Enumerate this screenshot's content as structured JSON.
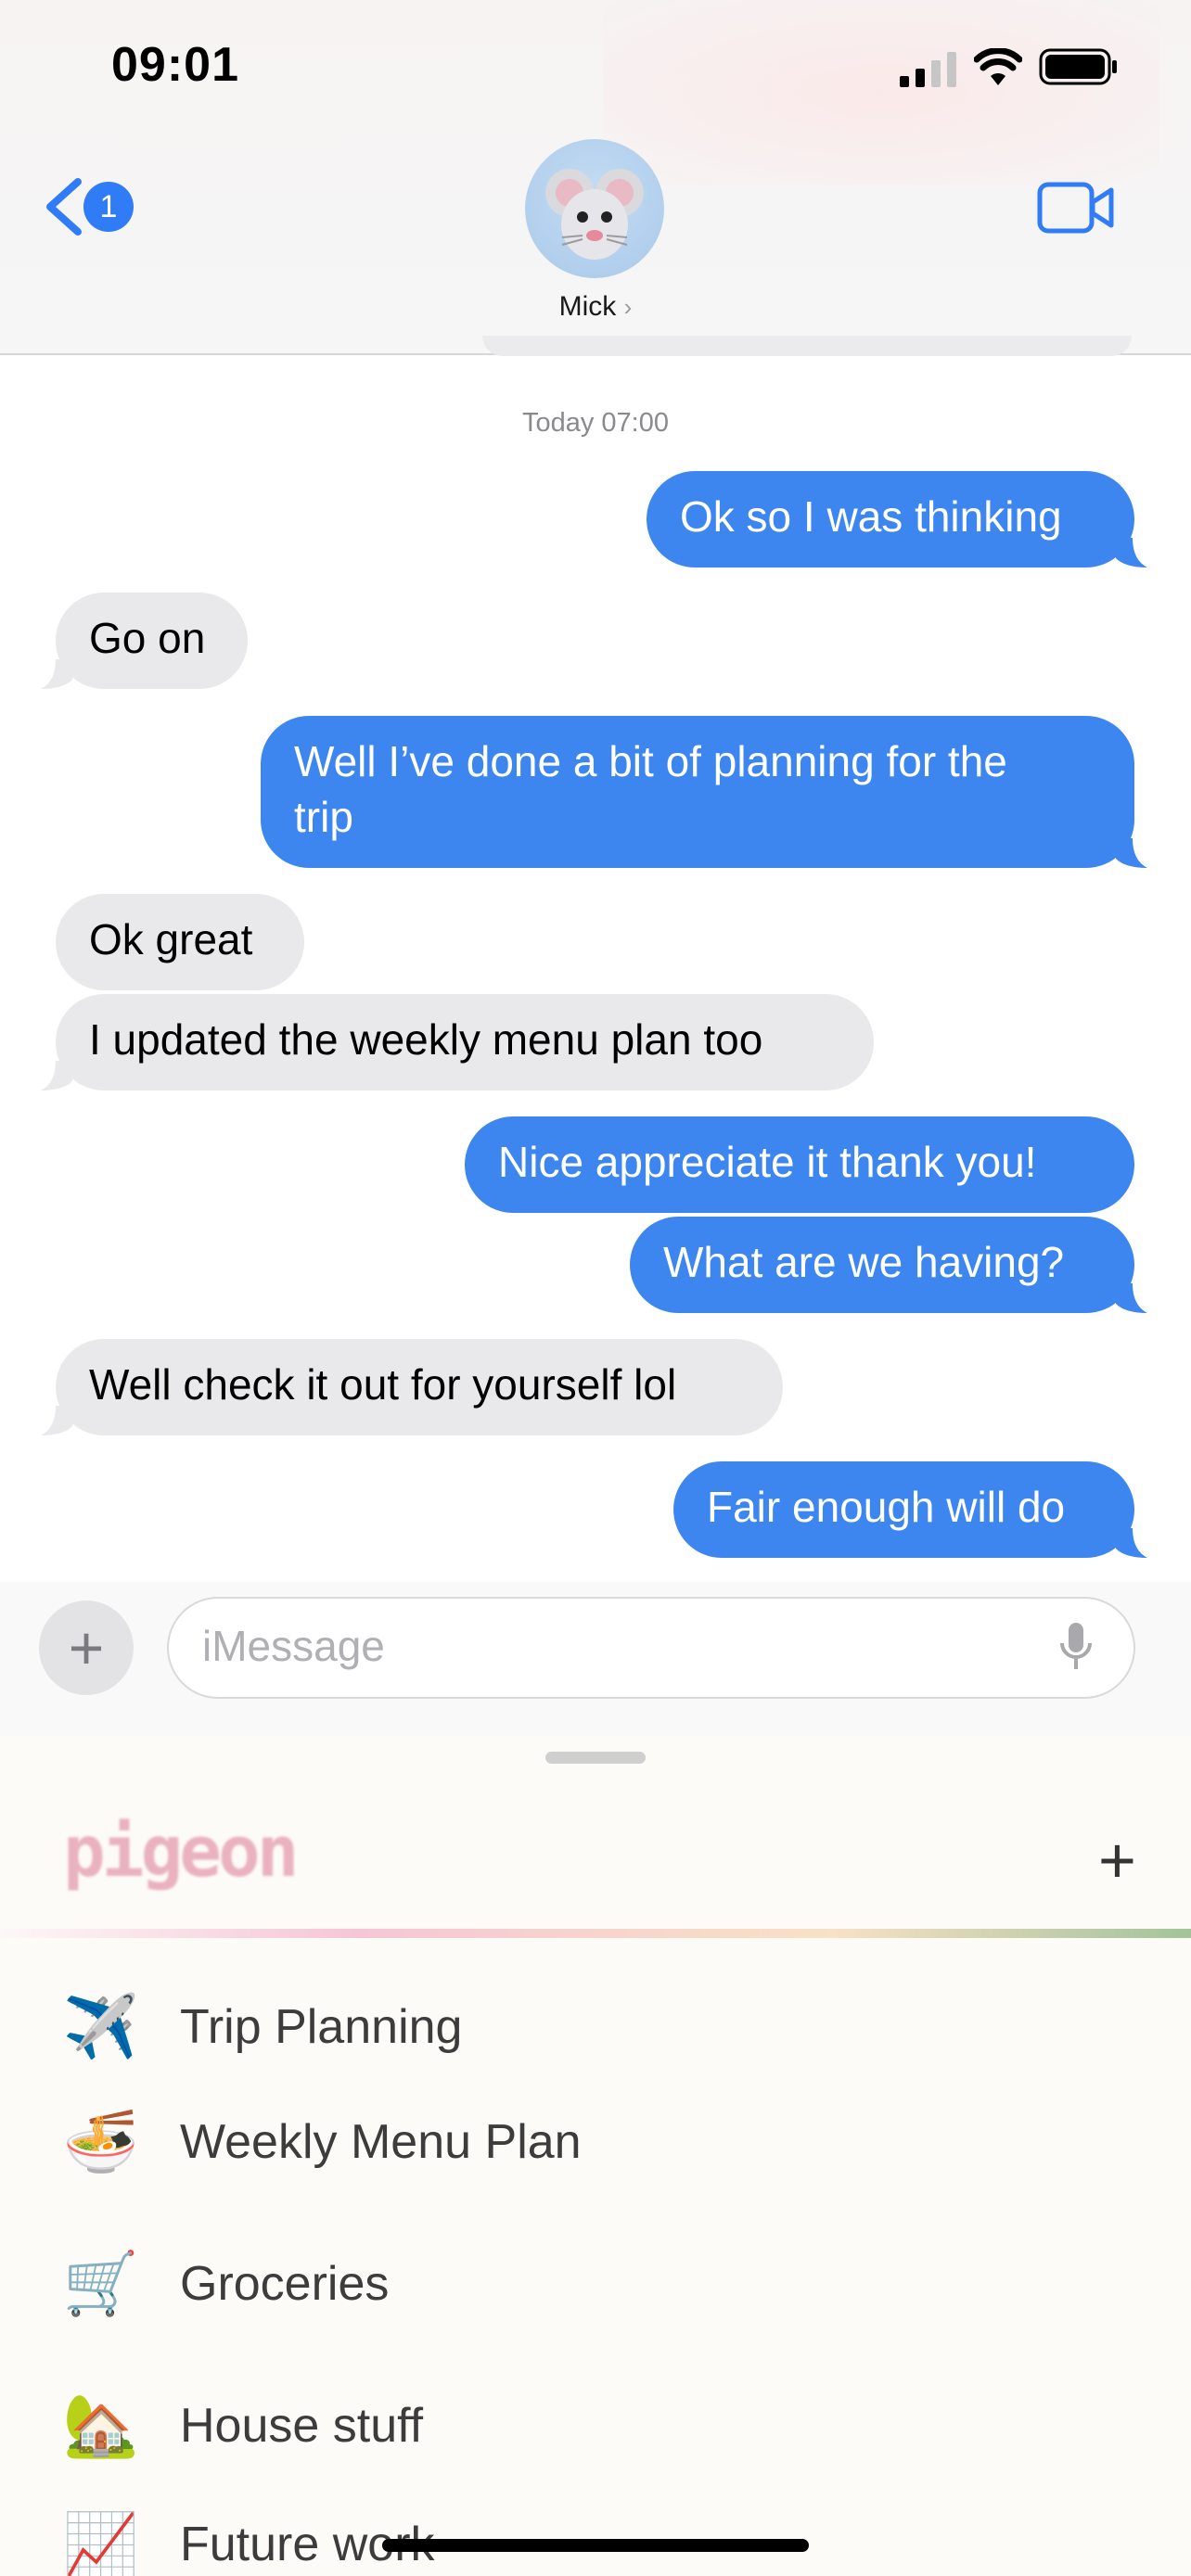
{
  "status_bar": {
    "time": "09:01"
  },
  "nav": {
    "back_count": "1",
    "contact_name": "Mick",
    "contact_chevron": "›"
  },
  "chat": {
    "timestamp": "Today 07:00",
    "messages": [
      {
        "direction": "outgoing",
        "text": "Ok so I was thinking"
      },
      {
        "direction": "incoming",
        "text": "Go on"
      },
      {
        "direction": "outgoing",
        "text_line1": "Well I’ve done a bit of planning for the",
        "text_line2": "trip"
      },
      {
        "direction": "incoming",
        "text": "Ok great"
      },
      {
        "direction": "incoming",
        "text": "I updated the weekly menu plan too"
      },
      {
        "direction": "outgoing",
        "text": "Nice appreciate it thank you!"
      },
      {
        "direction": "outgoing",
        "text": "What are we having?"
      },
      {
        "direction": "incoming",
        "text": "Well check it out for yourself lol"
      },
      {
        "direction": "outgoing",
        "text": "Fair enough will do"
      }
    ]
  },
  "composer": {
    "placeholder": "iMessage",
    "plus_symbol": "+"
  },
  "pigeon": {
    "logo": "pigeon",
    "add_symbol": "+",
    "lists": [
      {
        "emoji": "✈️",
        "label": "Trip Planning"
      },
      {
        "emoji": "🍜",
        "label": "Weekly Menu Plan"
      },
      {
        "emoji": "🛒",
        "label": "Groceries"
      },
      {
        "emoji": "🏡",
        "label": "House stuff"
      },
      {
        "emoji": "📈",
        "label": "Future work"
      }
    ]
  },
  "colors": {
    "outgoing": "#3d86f0",
    "incoming": "#e9e9eb",
    "accent": "#2f7cf6"
  }
}
